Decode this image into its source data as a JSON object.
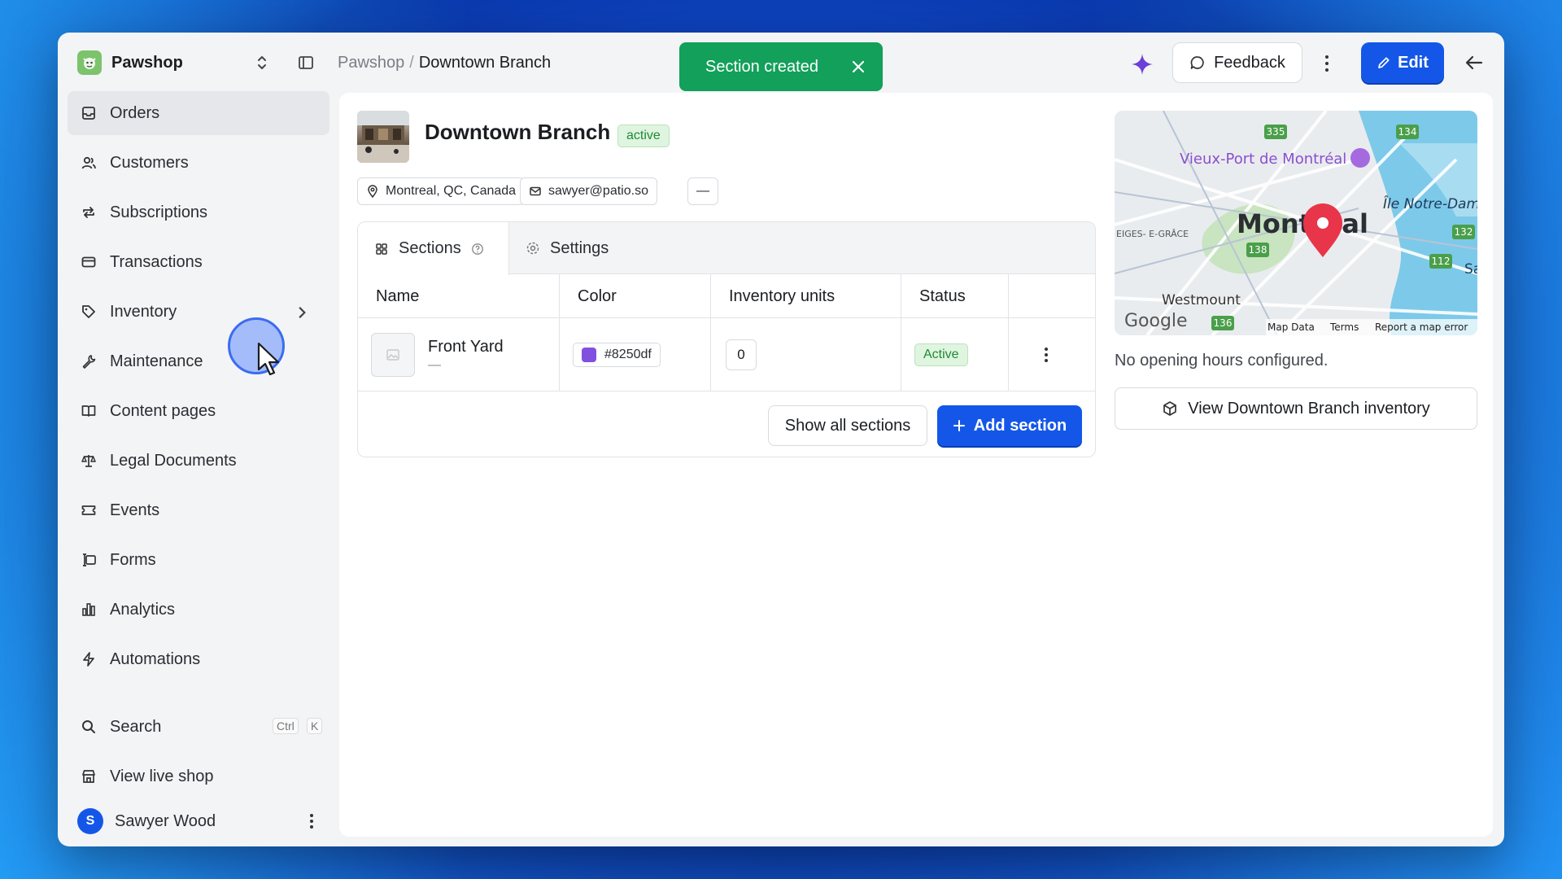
{
  "brand": {
    "name": "Pawshop"
  },
  "sidebar": {
    "items": [
      {
        "label": "Orders",
        "icon": "inbox-icon",
        "active": true
      },
      {
        "label": "Customers",
        "icon": "users-icon"
      },
      {
        "label": "Subscriptions",
        "icon": "repeat-icon"
      },
      {
        "label": "Transactions",
        "icon": "card-icon"
      },
      {
        "label": "Inventory",
        "icon": "tag-icon"
      },
      {
        "label": "Maintenance",
        "icon": "wrench-icon"
      },
      {
        "label": "Content pages",
        "icon": "book-icon"
      },
      {
        "label": "Legal Documents",
        "icon": "scale-icon"
      },
      {
        "label": "Events",
        "icon": "ticket-icon"
      },
      {
        "label": "Forms",
        "icon": "form-icon"
      },
      {
        "label": "Analytics",
        "icon": "bar-chart-icon"
      },
      {
        "label": "Automations",
        "icon": "bolt-icon"
      }
    ],
    "search": {
      "label": "Search",
      "kbd_ctrl": "Ctrl",
      "kbd_key": "K"
    },
    "live_shop": "View live shop",
    "user": {
      "initial": "S",
      "name": "Sawyer Wood"
    }
  },
  "breadcrumb": {
    "parent": "Pawshop",
    "separator": "/",
    "current": "Downtown Branch"
  },
  "toast": {
    "message": "Section created"
  },
  "header": {
    "feedback_label": "Feedback",
    "edit_label": "Edit"
  },
  "branch": {
    "title": "Downtown Branch",
    "status": "active",
    "location": "Montreal, QC, Canada",
    "email": "sawyer@patio.so",
    "extra_chip": "—"
  },
  "tabs": [
    {
      "label": "Sections",
      "active": true
    },
    {
      "label": "Settings",
      "active": false
    }
  ],
  "table": {
    "columns": [
      "Name",
      "Color",
      "Inventory units",
      "Status"
    ],
    "rows": [
      {
        "name": "Front Yard",
        "sub": "—",
        "color": "#8250df",
        "units": "0",
        "status": "Active"
      }
    ]
  },
  "actions": {
    "show_all": "Show all sections",
    "add_section": "Add section"
  },
  "map": {
    "city": "Montreal",
    "poi": "Vieux-Port de Montréal",
    "island": "Île Notre-Dam",
    "west": "Westmount",
    "nw": "EIGES-\nE-GRÂCE",
    "east": "Sai",
    "logo": "Google",
    "map_data": "Map Data",
    "terms": "Terms",
    "report": "Report a map error",
    "routes": [
      "335",
      "134",
      "138",
      "132",
      "112",
      "136"
    ]
  },
  "hours_text": "No opening hours configured.",
  "inventory_button": "View Downtown Branch inventory",
  "colors": {
    "primary": "#1457e8",
    "success": "#12a05a",
    "swatch": "#8250df",
    "active_bg": "#dff5df"
  }
}
